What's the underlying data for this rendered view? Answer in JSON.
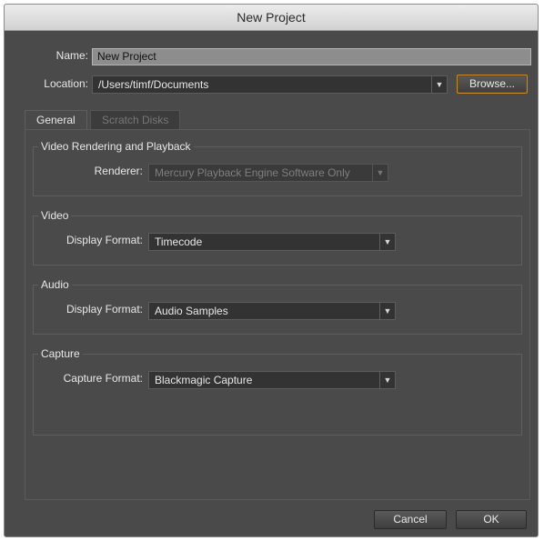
{
  "window": {
    "title": "New Project"
  },
  "form": {
    "name_label": "Name:",
    "name_value": "New Project",
    "location_label": "Location:",
    "location_value": "/Users/timf/Documents",
    "browse_label": "Browse..."
  },
  "tabs": [
    {
      "label": "General",
      "active": true
    },
    {
      "label": "Scratch Disks",
      "active": false
    }
  ],
  "groups": {
    "rendering": {
      "title": "Video Rendering and Playback",
      "renderer_label": "Renderer:",
      "renderer_value": "Mercury Playback Engine Software Only"
    },
    "video": {
      "title": "Video",
      "display_format_label": "Display Format:",
      "display_format_value": "Timecode"
    },
    "audio": {
      "title": "Audio",
      "display_format_label": "Display Format:",
      "display_format_value": "Audio Samples"
    },
    "capture": {
      "title": "Capture",
      "capture_format_label": "Capture Format:",
      "capture_format_value": "Blackmagic Capture"
    }
  },
  "footer": {
    "cancel_label": "Cancel",
    "ok_label": "OK"
  },
  "icons": {
    "dropdown": "chevron-down-icon"
  },
  "colors": {
    "background": "#4a4a4a",
    "accent": "#c8892a",
    "titlebar": "#dcdcdc"
  }
}
